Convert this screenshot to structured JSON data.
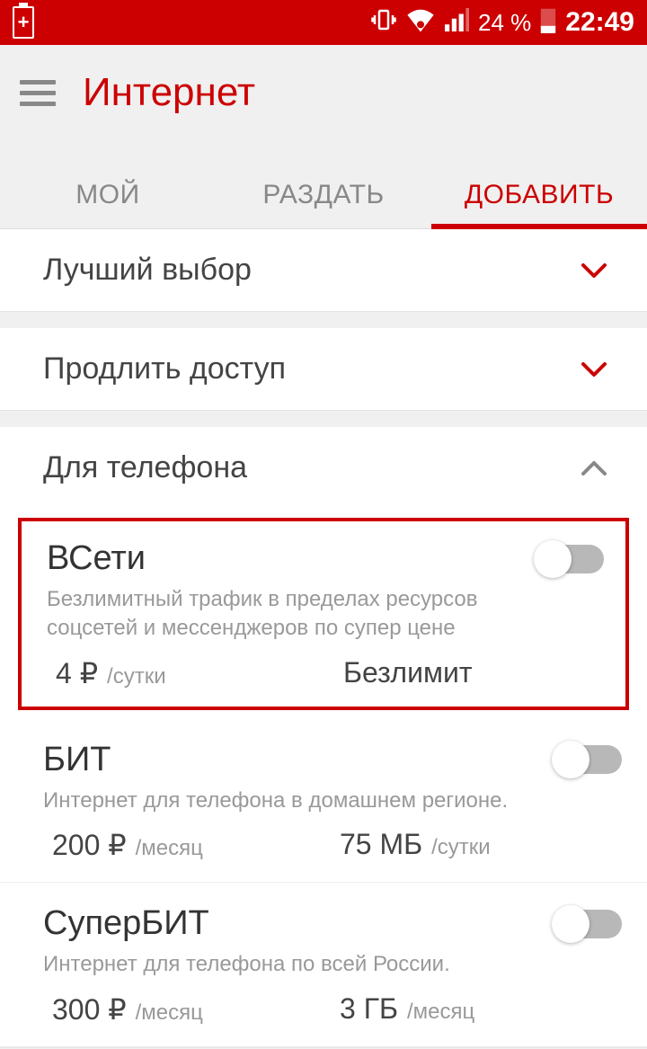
{
  "status": {
    "battery_percent": "24 %",
    "time": "22:49"
  },
  "header": {
    "title": "Интернет"
  },
  "tabs": [
    {
      "label": "МОЙ",
      "active": false
    },
    {
      "label": "РАЗДАТЬ",
      "active": false
    },
    {
      "label": "ДОБАВИТЬ",
      "active": true
    }
  ],
  "sections": {
    "best_choice": {
      "label": "Лучший выбор",
      "expanded": false
    },
    "extend_access": {
      "label": "Продлить доступ",
      "expanded": false
    },
    "for_phone": {
      "label": "Для телефона",
      "expanded": true
    }
  },
  "plans": [
    {
      "id": "vseti",
      "title": "ВСети",
      "description": "Безлимитный трафик в пределах ресурсов соцсетей и мессенджеров по супер цене",
      "price_value": "4 ₽",
      "price_unit": "/сутки",
      "data_value": "Безлимит",
      "data_unit": "",
      "highlighted": true,
      "enabled": false
    },
    {
      "id": "bit",
      "title": "БИТ",
      "description": "Интернет для телефона в домашнем регионе.",
      "price_value": "200 ₽",
      "price_unit": "/месяц",
      "data_value": "75 МБ",
      "data_unit": "/сутки",
      "highlighted": false,
      "enabled": false
    },
    {
      "id": "superbit",
      "title": "СуперБИТ",
      "description": "Интернет для телефона по всей России.",
      "price_value": "300 ₽",
      "price_unit": "/месяц",
      "data_value": "3 ГБ",
      "data_unit": "/месяц",
      "highlighted": false,
      "enabled": false
    }
  ],
  "colors": {
    "brand": "#cc0000"
  }
}
